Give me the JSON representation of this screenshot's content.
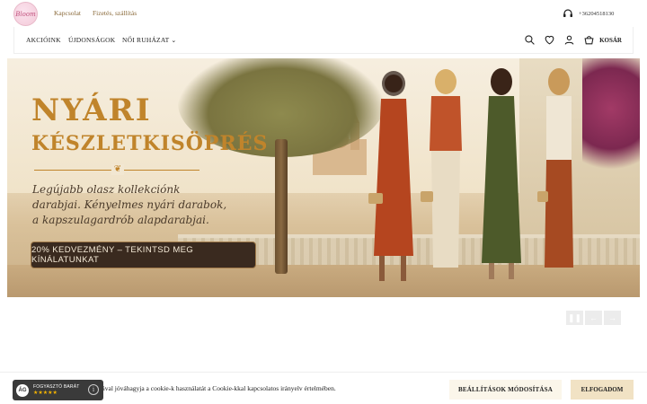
{
  "brand": {
    "logo_text": "Bloom",
    "accent": "#c0842b",
    "cta_bg": "#3a2a1f"
  },
  "topbar": {
    "links": [
      "Kapcsolat",
      "Fizetés, szállítás"
    ],
    "phone": "+36204518130",
    "phone_icon": "headset-icon"
  },
  "nav": {
    "items": [
      "AKCIÓINK",
      "ÚJDONSÁGOK",
      "NŐI RUHÁZAT"
    ],
    "icons": [
      "search-icon",
      "heart-icon",
      "user-icon",
      "cart-icon"
    ],
    "cart_label": "KOSÁR"
  },
  "hero": {
    "title_line1": "NYÁRI",
    "title_line2": "KÉSZLETKISÖPRÉS",
    "description": "Legújabb olasz kollekciónk darabjai. Kényelmes nyári darabok, a kapszulagardrób alapdarabjai.",
    "cta": "20% KEDVEZMÉNY – TEKINTSD MEG KÍNÁLATUNKAT"
  },
  "slider": {
    "controls": [
      "pause-icon",
      "prev-arrow-icon",
      "next-arrow-icon"
    ]
  },
  "cookie": {
    "text": "atával jóváhagyja a cookie-k használatát a Cookie-kkal kapcsolatos irányelv értelmében.",
    "settings_button": "BEÁLLÍTÁSOK MÓDOSÍTÁSA",
    "accept_button": "ELFOGADOM"
  },
  "trust_badge": {
    "title": "FOGYASZTÓ BARÁT",
    "stars": "★★★★★",
    "logo": "ÁG"
  }
}
